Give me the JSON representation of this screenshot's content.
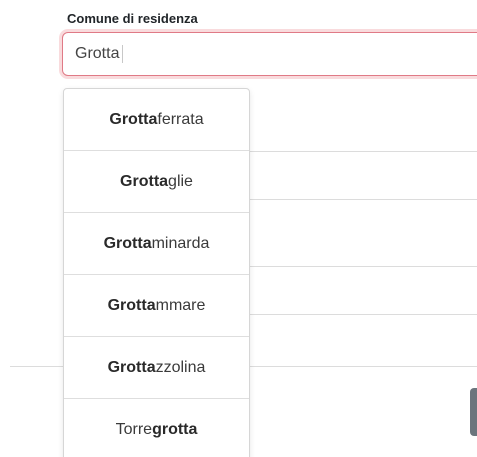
{
  "form": {
    "label": "Comune di residenza",
    "input_value": "Grotta"
  },
  "autocomplete": {
    "options": [
      {
        "pre": "",
        "match": "Grotta",
        "post": "ferrata"
      },
      {
        "pre": "",
        "match": "Grotta",
        "post": "glie"
      },
      {
        "pre": "",
        "match": "Grotta",
        "post": "minarda"
      },
      {
        "pre": "",
        "match": "Grotta",
        "post": "mmare"
      },
      {
        "pre": "",
        "match": "Grotta",
        "post": "zzolina"
      },
      {
        "pre": "Torre",
        "match": "grotta",
        "post": ""
      }
    ]
  },
  "colors": {
    "input_border": "#e07a86",
    "input_focus_ring": "#dc3545",
    "background_button": "#6c757d"
  }
}
